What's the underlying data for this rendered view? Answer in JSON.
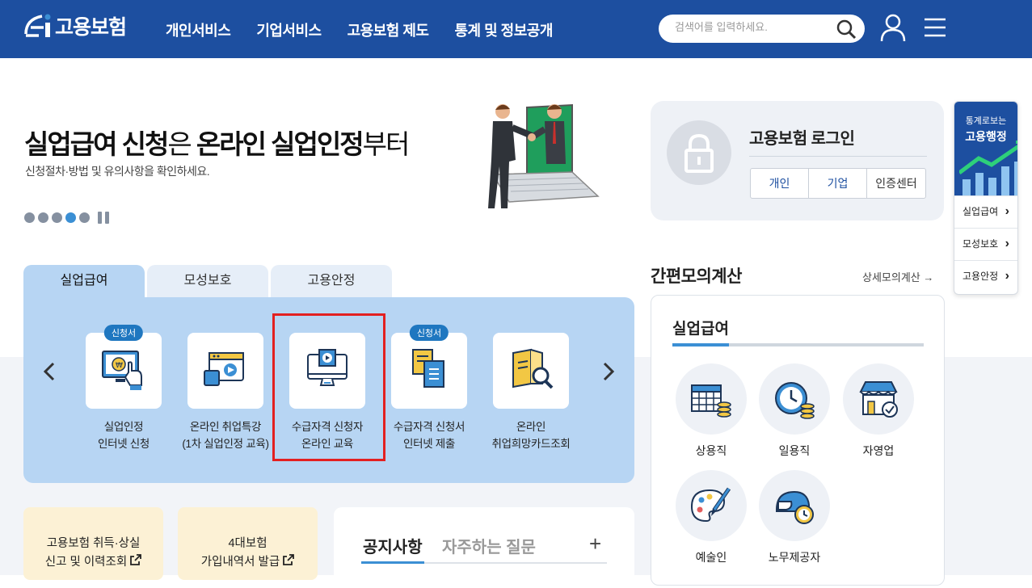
{
  "header": {
    "logo_text": "고용보험",
    "nav": [
      "개인서비스",
      "기업서비스",
      "고용보험 제도",
      "통계 및 정보공개"
    ],
    "search_placeholder": "검색어를 입력하세요."
  },
  "hero": {
    "title_a": "실업급여 신청",
    "title_b": "은 ",
    "title_c": "온라인 실업인정",
    "title_d": "부터",
    "subtitle": "신청절차·방법 및 유의사항을 확인하세요.",
    "slide_count": 5,
    "active_slide": 4
  },
  "login": {
    "title": "고용보험 로그인",
    "buttons": [
      "개인",
      "기업",
      "인증센터"
    ]
  },
  "quick": {
    "top_line1": "통계로보는",
    "top_line2": "고용행정",
    "items": [
      "실업급여",
      "모성보호",
      "고용안정"
    ]
  },
  "tabs": [
    "실업급여",
    "모성보호",
    "고용안정"
  ],
  "services": [
    {
      "badge": "신청서",
      "line1": "실업인정",
      "line2": "인터넷 신청",
      "icon": "monitor-coin-icon"
    },
    {
      "badge": "",
      "line1": "온라인 취업특강",
      "line2": "(1차 실업인정 교육)",
      "icon": "video-window-icon"
    },
    {
      "badge": "",
      "line1": "수급자격 신청자",
      "line2": "온라인 교육",
      "icon": "monitor-play-icon"
    },
    {
      "badge": "신청서",
      "line1": "수급자격 신청서",
      "line2": "인터넷 제출",
      "icon": "documents-icon"
    },
    {
      "badge": "",
      "line1": "온라인",
      "line2": "취업희망카드조회",
      "icon": "card-search-icon"
    }
  ],
  "calc": {
    "heading": "간편모의계산",
    "more": "상세모의계산 →",
    "title": "실업급여",
    "items": [
      "상용직",
      "일용직",
      "자영업",
      "예술인",
      "노무제공자"
    ]
  },
  "cards": [
    {
      "line1": "고용보험 취득·상실",
      "line2": "신고 및 이력조회"
    },
    {
      "line1": "4대보험",
      "line2": "가입내역서 발급"
    }
  ],
  "notice": {
    "tab1": "공지사항",
    "tab2": "자주하는 질문",
    "plus": "+"
  },
  "colors": {
    "header": "#1d4fa0",
    "accent": "#3b8fd4",
    "panel": "#b7d5f3",
    "highlight": "#e32020"
  }
}
